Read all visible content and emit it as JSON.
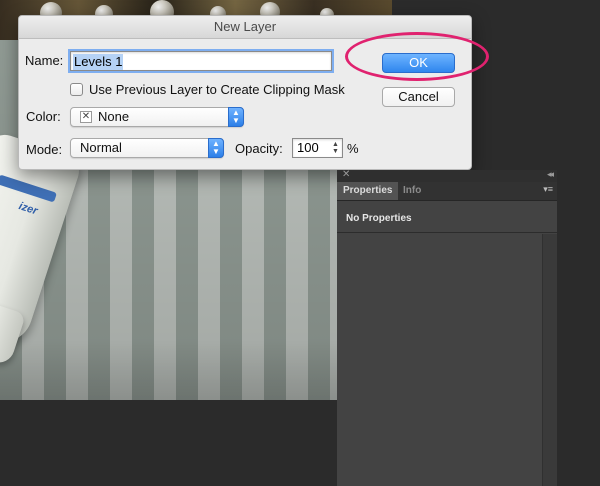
{
  "dialog": {
    "title": "New Layer",
    "name_label": "Name:",
    "name_value": "Levels 1",
    "clipping_label": "Use Previous Layer to Create Clipping Mask",
    "color_label": "Color:",
    "color_value": "None",
    "mode_label": "Mode:",
    "mode_value": "Normal",
    "opacity_label": "Opacity:",
    "opacity_value": "100",
    "opacity_unit": "%",
    "ok_label": "OK",
    "cancel_label": "Cancel"
  },
  "panel": {
    "tabs": [
      {
        "label": "Properties"
      },
      {
        "label": "Info"
      }
    ],
    "empty_text": "No Properties"
  },
  "photo": {
    "tube_text": "izer"
  },
  "colors": {
    "accent": "#2f86ee",
    "highlight": "#e0226f",
    "panel_bg": "#434343",
    "app_bg": "#2b2b2b"
  },
  "icons": {
    "close": "close-icon",
    "collapse": "double-chevron-icon",
    "panel_menu": "panel-menu-icon",
    "popup_arrows": "up-down-arrows-icon"
  }
}
